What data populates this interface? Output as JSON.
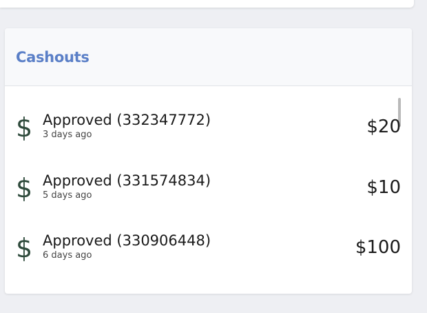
{
  "cashouts": {
    "title": "Cashouts",
    "items": [
      {
        "icon": "dollar-icon",
        "status": "Approved (332347772)",
        "time": "3 days ago",
        "amount": "$20"
      },
      {
        "icon": "dollar-icon",
        "status": "Approved (331574834)",
        "time": "5 days ago",
        "amount": "$10"
      },
      {
        "icon": "dollar-icon",
        "status": "Approved (330906448)",
        "time": "6 days ago",
        "amount": "$100"
      }
    ]
  },
  "colors": {
    "title": "#5a7fc7",
    "icon": "#2e4a3b",
    "background": "#eeeff3"
  }
}
